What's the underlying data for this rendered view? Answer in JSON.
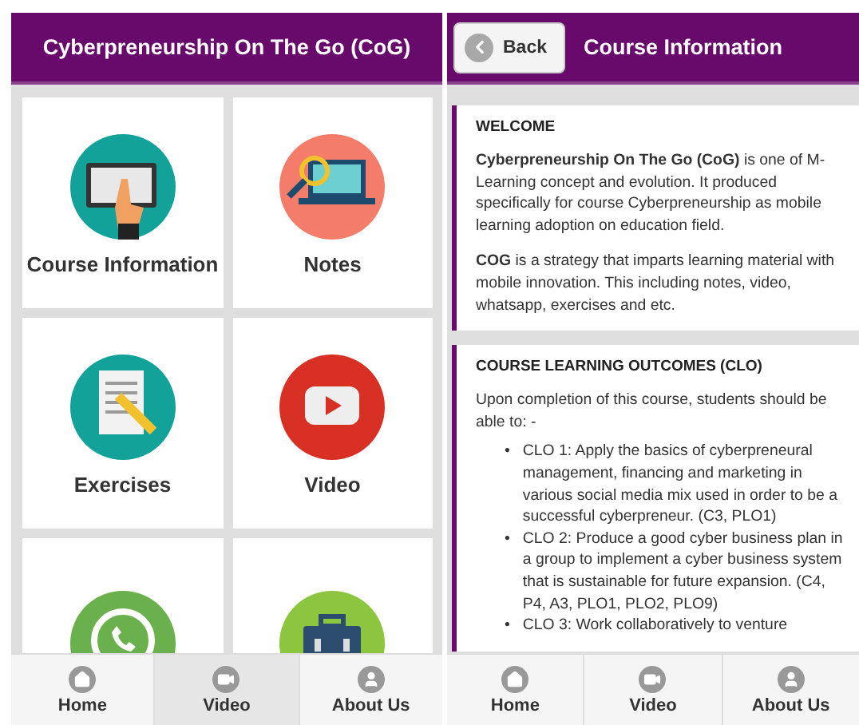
{
  "home_screen": {
    "title": "Cyberpreneurship On The Go (CoG)",
    "tiles": [
      "Course Information",
      "Notes",
      "Exercises",
      "Video"
    ],
    "nav": [
      {
        "label": "Home",
        "selected": false
      },
      {
        "label": "Video",
        "selected": true
      },
      {
        "label": "About Us",
        "selected": false
      }
    ]
  },
  "info_screen": {
    "back_button": "Back",
    "title": "Course Information",
    "sections": [
      {
        "heading": "WELCOME",
        "paragraphs": [
          "**Cyberpreneurship On The Go (CoG)** is one of M-Learning concept and evolution. It produced specifically for course Cyberpreneurship as mobile learning adoption on education field.",
          "**COG** is a strategy that imparts learning material with mobile innovation. This including notes, video, whatsapp, exercises and etc."
        ]
      },
      {
        "heading": "COURSE LEARNING OUTCOMES (CLO)",
        "paragraphs": [
          "Upon completion of this course, students should be able to: -"
        ],
        "bullets": [
          {
            "marker": "•",
            "text": "CLO 1: Apply the basics of cyberpreneural management, financing and marketing in various social media mix used in order to be a successful cyberpreneur. (C3, PLO1)"
          },
          {
            "marker": "•",
            "text": "CLO 2: Produce a good cyber business plan in a group to implement a cyber business system that is sustainable for future expansion. (C4, P4, A3, PLO1, PLO2, PLO9)"
          },
          {
            "marker": "•",
            "text": "CLO 3: Work collaboratively to venture"
          }
        ]
      }
    ],
    "nav": [
      {
        "label": "Home",
        "selected": false
      },
      {
        "label": "Video",
        "selected": false
      },
      {
        "label": "About Us",
        "selected": false
      }
    ]
  }
}
